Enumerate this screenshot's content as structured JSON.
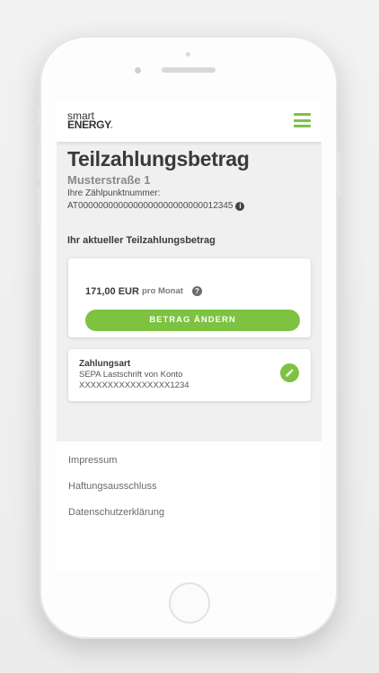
{
  "header": {
    "logo_line1": "smart",
    "logo_line2": "ENERGY",
    "logo_dot": "."
  },
  "page": {
    "title": "Teilzahlungsbetrag",
    "address": "Musterstraße 1",
    "meter_label": "Ihre Zählpunktnummer:",
    "meter_number": "AT0000000000000000000000000012345",
    "info_icon": "i"
  },
  "installment": {
    "section_title": "Ihr aktueller Teilzahlungsbetrag",
    "amount": "171,00 EUR",
    "period": "pro Monat",
    "help_icon": "?",
    "change_button": "BETRAG ÄNDERN"
  },
  "payment": {
    "title": "Zahlungsart",
    "method": "SEPA Lastschrift von Konto",
    "account": "XXXXXXXXXXXXXXXX1234"
  },
  "footer": {
    "links": [
      "Impressum",
      "Haftungsausschluss",
      "Datenschutzerklärung"
    ]
  },
  "colors": {
    "accent": "#7dc241",
    "text": "#3a3a3a",
    "muted": "#8a8a8a"
  }
}
